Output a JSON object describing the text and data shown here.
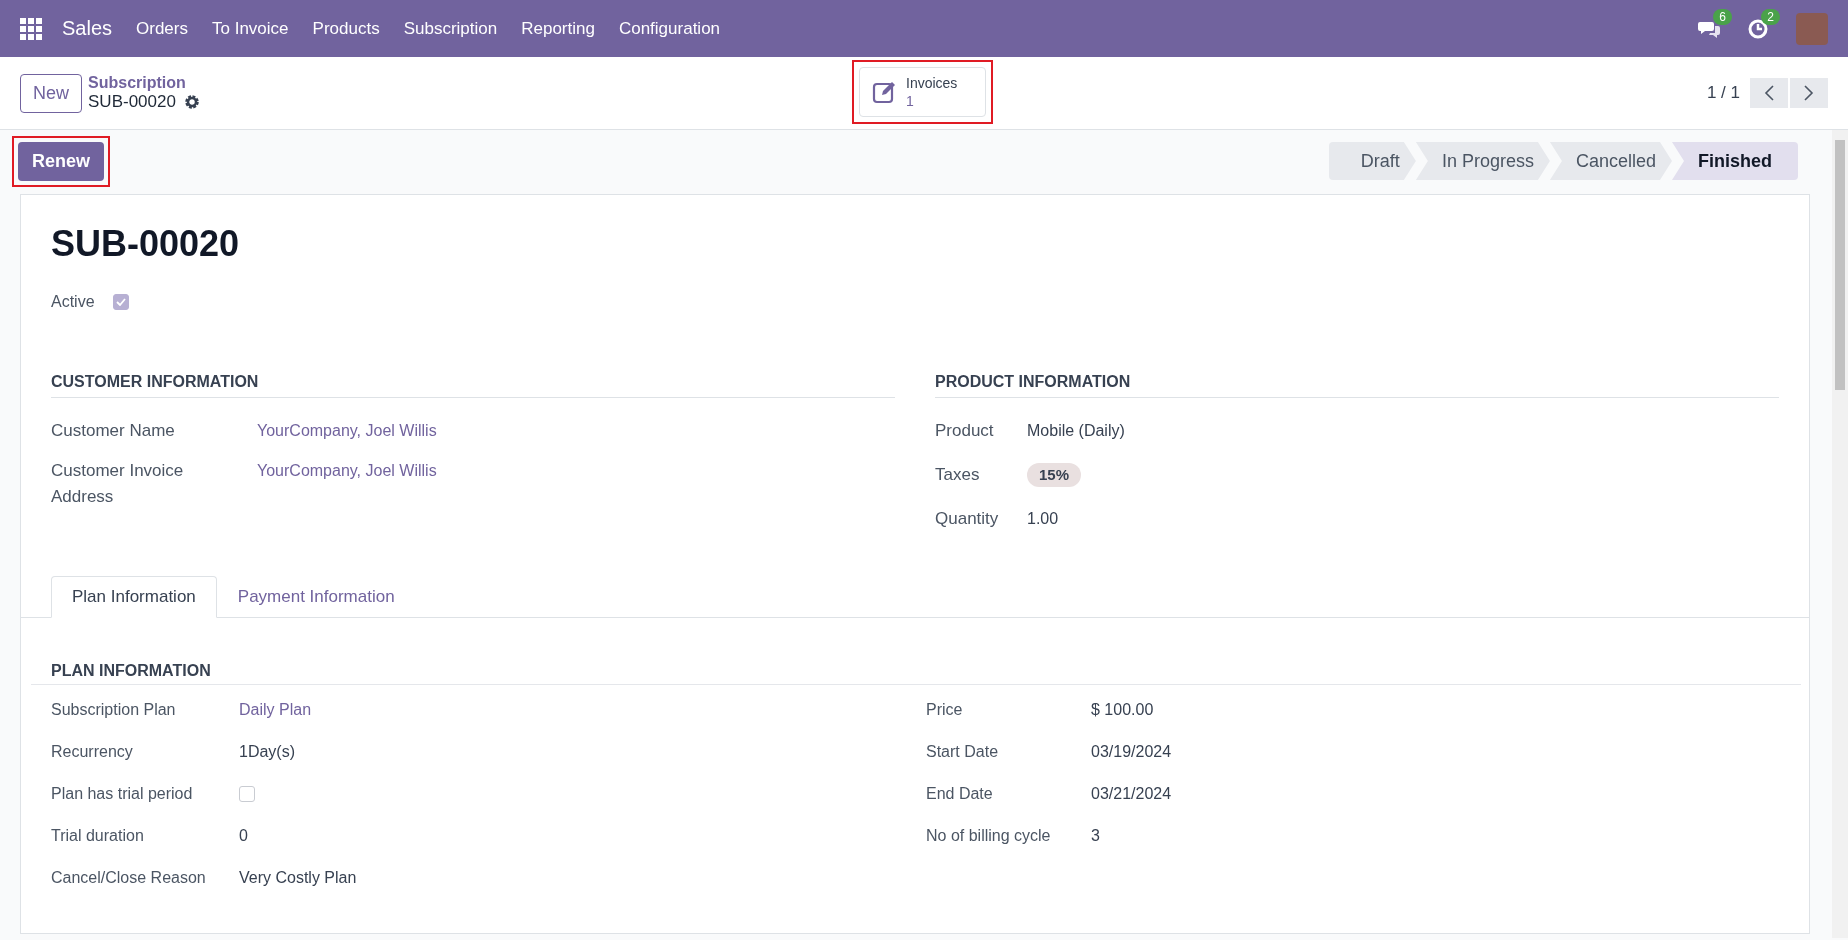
{
  "navbar": {
    "app_name": "Sales",
    "menu": [
      "Orders",
      "To Invoice",
      "Products",
      "Subscription",
      "Reporting",
      "Configuration"
    ],
    "chat_count": "6",
    "activity_count": "2"
  },
  "control_panel": {
    "new_button": "New",
    "breadcrumb": "Subscription",
    "record": "SUB-00020",
    "smart_button": {
      "label": "Invoices",
      "count": "1",
      "highlighted": true
    },
    "pager": "1 / 1"
  },
  "action_button": {
    "label": "Renew",
    "highlighted": true
  },
  "stages": [
    {
      "label": "Draft",
      "selected": false
    },
    {
      "label": "In Progress",
      "selected": false
    },
    {
      "label": "Cancelled",
      "selected": false
    },
    {
      "label": "Finished",
      "selected": true
    }
  ],
  "form": {
    "title": "SUB-00020",
    "active": {
      "label": "Active",
      "checked": true
    },
    "customer_section": {
      "title": "CUSTOMER INFORMATION",
      "fields": [
        {
          "label": "Customer Name",
          "value": "YourCompany, Joel Willis",
          "kind": "link"
        },
        {
          "label": "Customer Invoice Address",
          "value": "YourCompany, Joel Willis",
          "kind": "link"
        }
      ]
    },
    "product_section": {
      "title": "PRODUCT INFORMATION",
      "fields": [
        {
          "label": "Product",
          "value": "Mobile (Daily)",
          "kind": "text"
        },
        {
          "label": "Taxes",
          "value": "15%",
          "kind": "tag"
        },
        {
          "label": "Quantity",
          "value": "1.00",
          "kind": "text"
        }
      ]
    },
    "tabs": [
      {
        "label": "Plan Information",
        "selected": true
      },
      {
        "label": "Payment Information",
        "selected": false
      }
    ],
    "plan_section": {
      "title": "PLAN INFORMATION",
      "left_fields": [
        {
          "label": "Subscription Plan",
          "value": "Daily Plan",
          "kind": "link"
        },
        {
          "label": "Recurrency",
          "value": "1Day(s)",
          "kind": "text"
        },
        {
          "label": "Plan has trial period",
          "checked": false,
          "kind": "checkbox"
        },
        {
          "label": "Trial duration",
          "value": "0",
          "kind": "text"
        },
        {
          "label": "Cancel/Close Reason",
          "value": "Very Costly Plan",
          "kind": "text"
        }
      ],
      "right_fields": [
        {
          "label": "Price",
          "value": "$ 100.00",
          "kind": "text"
        },
        {
          "label": "Start Date",
          "value": "03/19/2024",
          "kind": "text"
        },
        {
          "label": "End Date",
          "value": "03/21/2024",
          "kind": "text"
        },
        {
          "label": "No of billing cycle",
          "value": "3",
          "kind": "text"
        }
      ]
    }
  }
}
